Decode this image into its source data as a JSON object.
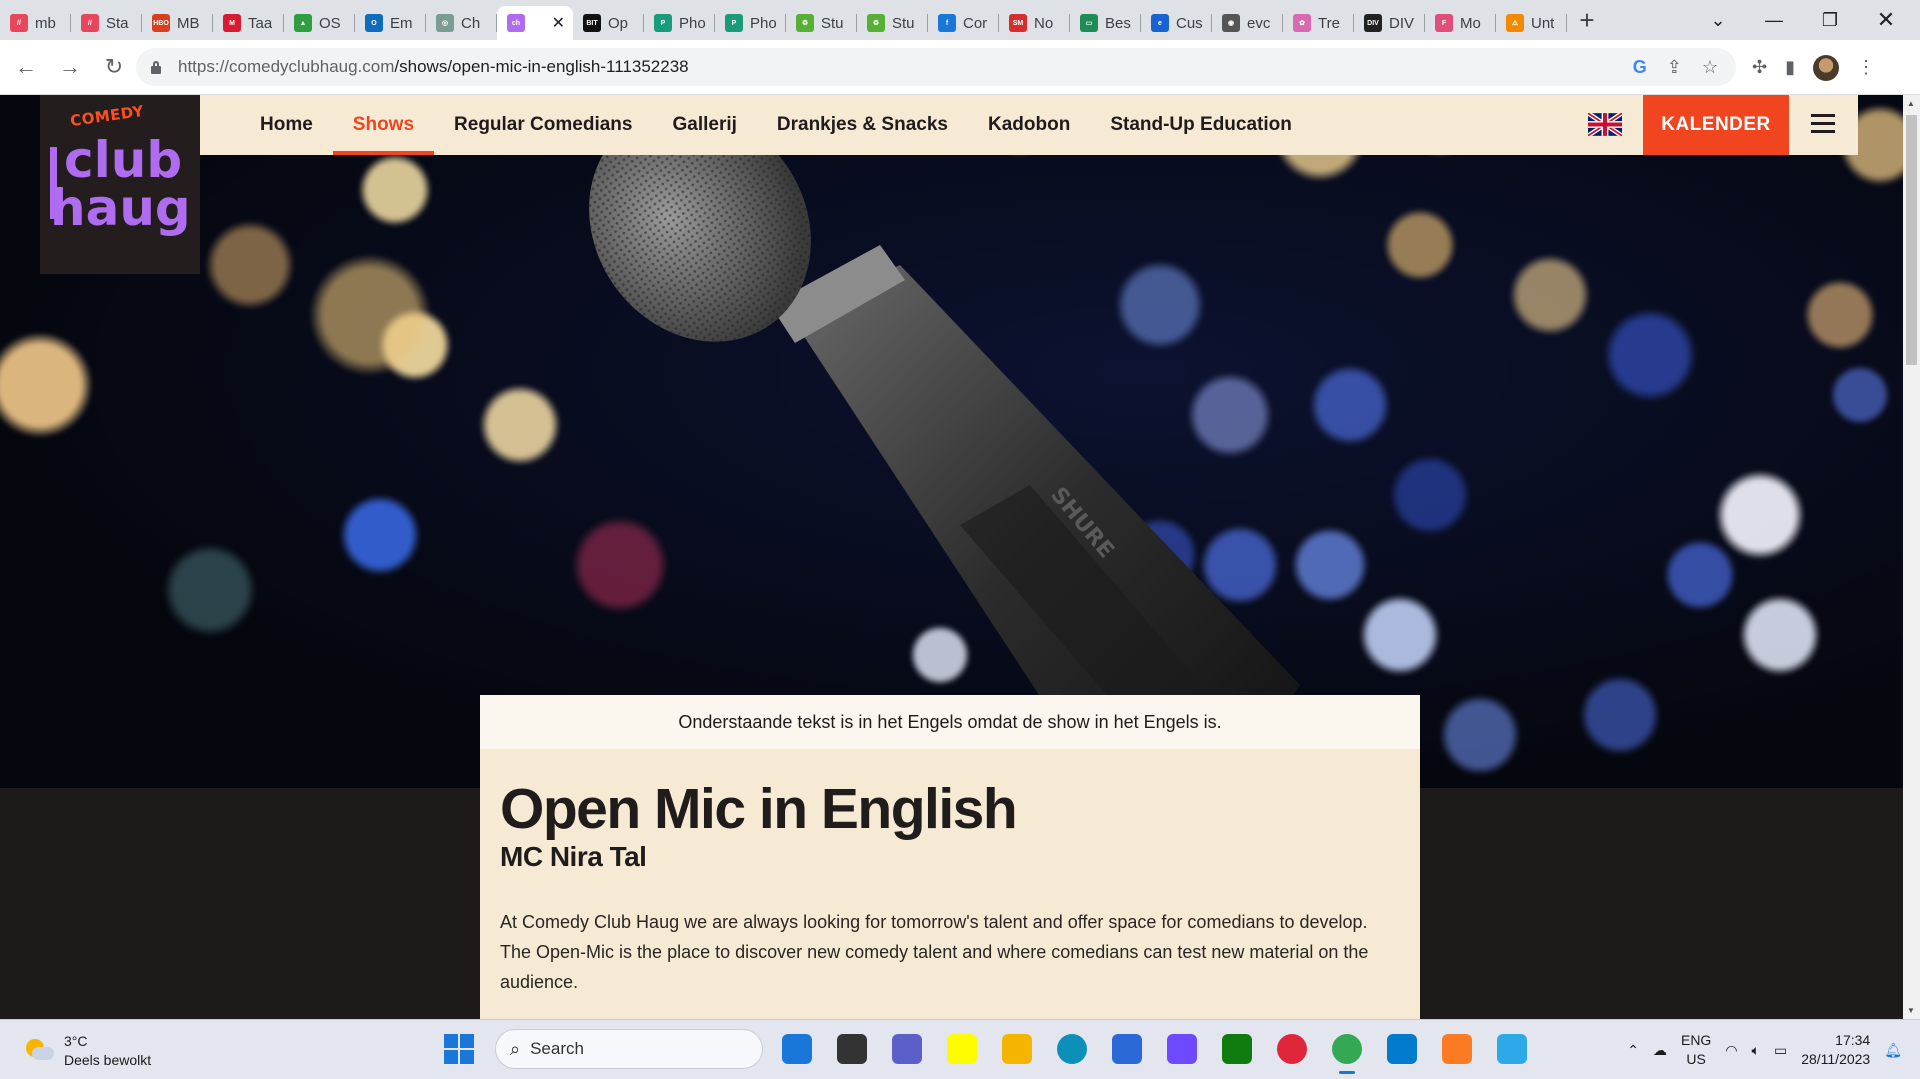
{
  "browser": {
    "tabs": [
      {
        "title": "mb",
        "favicon_color": "#e8465a",
        "glyph": "//"
      },
      {
        "title": "Sta",
        "favicon_color": "#e8465a",
        "glyph": "//"
      },
      {
        "title": "MB",
        "favicon_color": "#d93f1f",
        "glyph": "HBO"
      },
      {
        "title": "Taa",
        "favicon_color": "#d71b33",
        "glyph": "M"
      },
      {
        "title": "OS",
        "favicon_color": "#2e9e3e",
        "glyph": "▲"
      },
      {
        "title": "Em",
        "favicon_color": "#0f6cbd",
        "glyph": "O"
      },
      {
        "title": "Ch",
        "favicon_color": "#7a9c94",
        "glyph": "◎"
      },
      {
        "title": "",
        "favicon_color": "#b06cf0",
        "glyph": "ch",
        "active": true
      },
      {
        "title": "Op",
        "favicon_color": "#111111",
        "glyph": "BIT"
      },
      {
        "title": "Pho",
        "favicon_color": "#1a9b7a",
        "glyph": "P"
      },
      {
        "title": "Pho",
        "favicon_color": "#1a9b7a",
        "glyph": "P"
      },
      {
        "title": "Stu",
        "favicon_color": "#55b035",
        "glyph": "♻"
      },
      {
        "title": "Stu",
        "favicon_color": "#55b035",
        "glyph": "♻"
      },
      {
        "title": "Cor",
        "favicon_color": "#1877d8",
        "glyph": "f"
      },
      {
        "title": "No",
        "favicon_color": "#d82d2d",
        "glyph": "SM"
      },
      {
        "title": "Bes",
        "favicon_color": "#1f8b56",
        "glyph": "▭"
      },
      {
        "title": "Cus",
        "favicon_color": "#1763d1",
        "glyph": "e"
      },
      {
        "title": "evc",
        "favicon_color": "#555555",
        "glyph": "◉"
      },
      {
        "title": "Tre",
        "favicon_color": "#d96ab0",
        "glyph": "✿"
      },
      {
        "title": "DIV",
        "favicon_color": "#222222",
        "glyph": "DIV"
      },
      {
        "title": "Mo",
        "favicon_color": "#e04f7b",
        "glyph": "F"
      },
      {
        "title": "Unt",
        "favicon_color": "#f28a00",
        "glyph": "⚠"
      }
    ],
    "url_host": "https://comedyclubhaug.com",
    "url_path": "/shows/open-mic-in-english-111352238"
  },
  "site": {
    "logo": {
      "comedy": "COMEDY",
      "club": "club",
      "haug": "haug"
    },
    "nav": [
      {
        "label": "Home",
        "current": false
      },
      {
        "label": "Shows",
        "current": true
      },
      {
        "label": "Regular Comedians",
        "current": false
      },
      {
        "label": "Gallerij",
        "current": false
      },
      {
        "label": "Drankjes & Snacks",
        "current": false
      },
      {
        "label": "Kadobon",
        "current": false
      },
      {
        "label": "Stand-Up Education",
        "current": false
      }
    ],
    "calendar_button": "KALENDER",
    "language_flag": "uk-flag-icon"
  },
  "show": {
    "notice": "Onderstaande tekst is in het Engels omdat de show in het Engels is.",
    "title": "Open Mic in English",
    "subtitle": "MC Nira Tal",
    "description": "At Comedy Club Haug we are always looking for tomorrow's talent and offer space for comedians to develop. The Open-Mic is the place to discover new comedy talent and where comedians can test new material on the audience.",
    "mic_brand": "SHURE"
  },
  "taskbar": {
    "weather_temp": "3°C",
    "weather_desc": "Deels bewolkt",
    "search_placeholder": "Search",
    "lang_top": "ENG",
    "lang_bottom": "US",
    "time": "17:34",
    "date": "28/11/2023",
    "apps": [
      {
        "name": "bing-icon",
        "color": "#1877d8"
      },
      {
        "name": "task-view-icon",
        "color": "#333333"
      },
      {
        "name": "teams-icon",
        "color": "#5b5fc7"
      },
      {
        "name": "snapchat-icon",
        "color": "#fffc00"
      },
      {
        "name": "file-explorer-icon",
        "color": "#f4b400"
      },
      {
        "name": "edge-icon",
        "color": "#0c8fb9"
      },
      {
        "name": "store-icon",
        "color": "#2b6ad6"
      },
      {
        "name": "proton-icon",
        "color": "#6d4aff"
      },
      {
        "name": "xbox-icon",
        "color": "#107c10"
      },
      {
        "name": "opera-icon",
        "color": "#e0263a"
      },
      {
        "name": "chrome-icon",
        "color": "#34a853",
        "active": true
      },
      {
        "name": "vscode-icon",
        "color": "#007acc"
      },
      {
        "name": "xampp-icon",
        "color": "#fb7a24"
      },
      {
        "name": "filezilla-icon",
        "color": "#2fa8e8"
      }
    ]
  }
}
